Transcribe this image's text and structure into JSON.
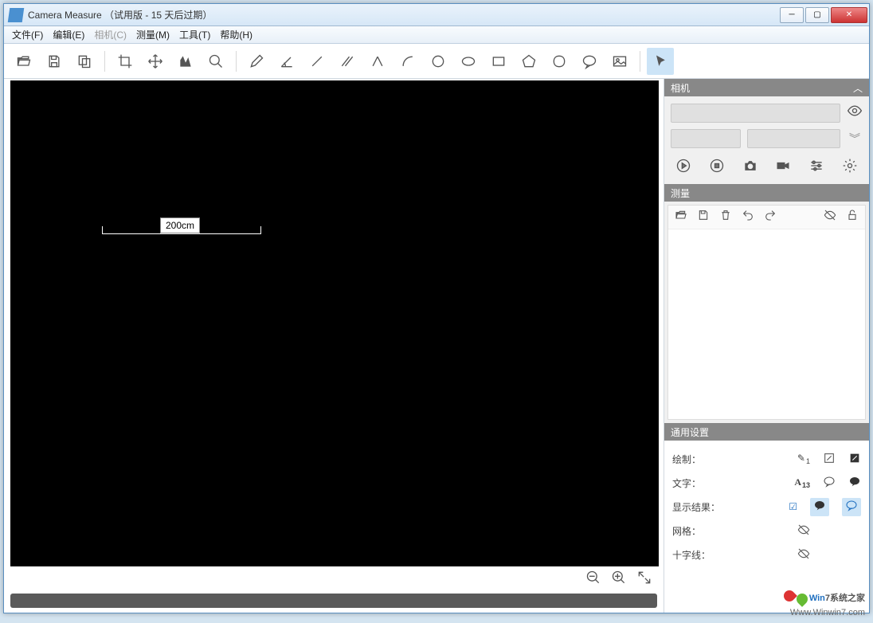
{
  "window": {
    "title": "Camera Measure （试用版 - 15 天后过期）"
  },
  "menu": {
    "file": "文件(F)",
    "edit": "编辑(E)",
    "camera": "相机(C)",
    "measure": "测量(M)",
    "tool": "工具(T)",
    "help": "帮助(H)"
  },
  "canvas": {
    "measurement_label": "200cm"
  },
  "panels": {
    "camera_title": "相机",
    "measure_title": "测量",
    "settings_title": "通用设置"
  },
  "settings": {
    "draw_label": "绘制：",
    "draw_value": "1",
    "text_label": "文字：",
    "text_value": "13",
    "result_label": "显示结果：",
    "grid_label": "网格：",
    "cross_label": "十字线："
  },
  "watermark": {
    "line1": "Win7系统之家",
    "line2": "Www.Winwin7.com"
  }
}
